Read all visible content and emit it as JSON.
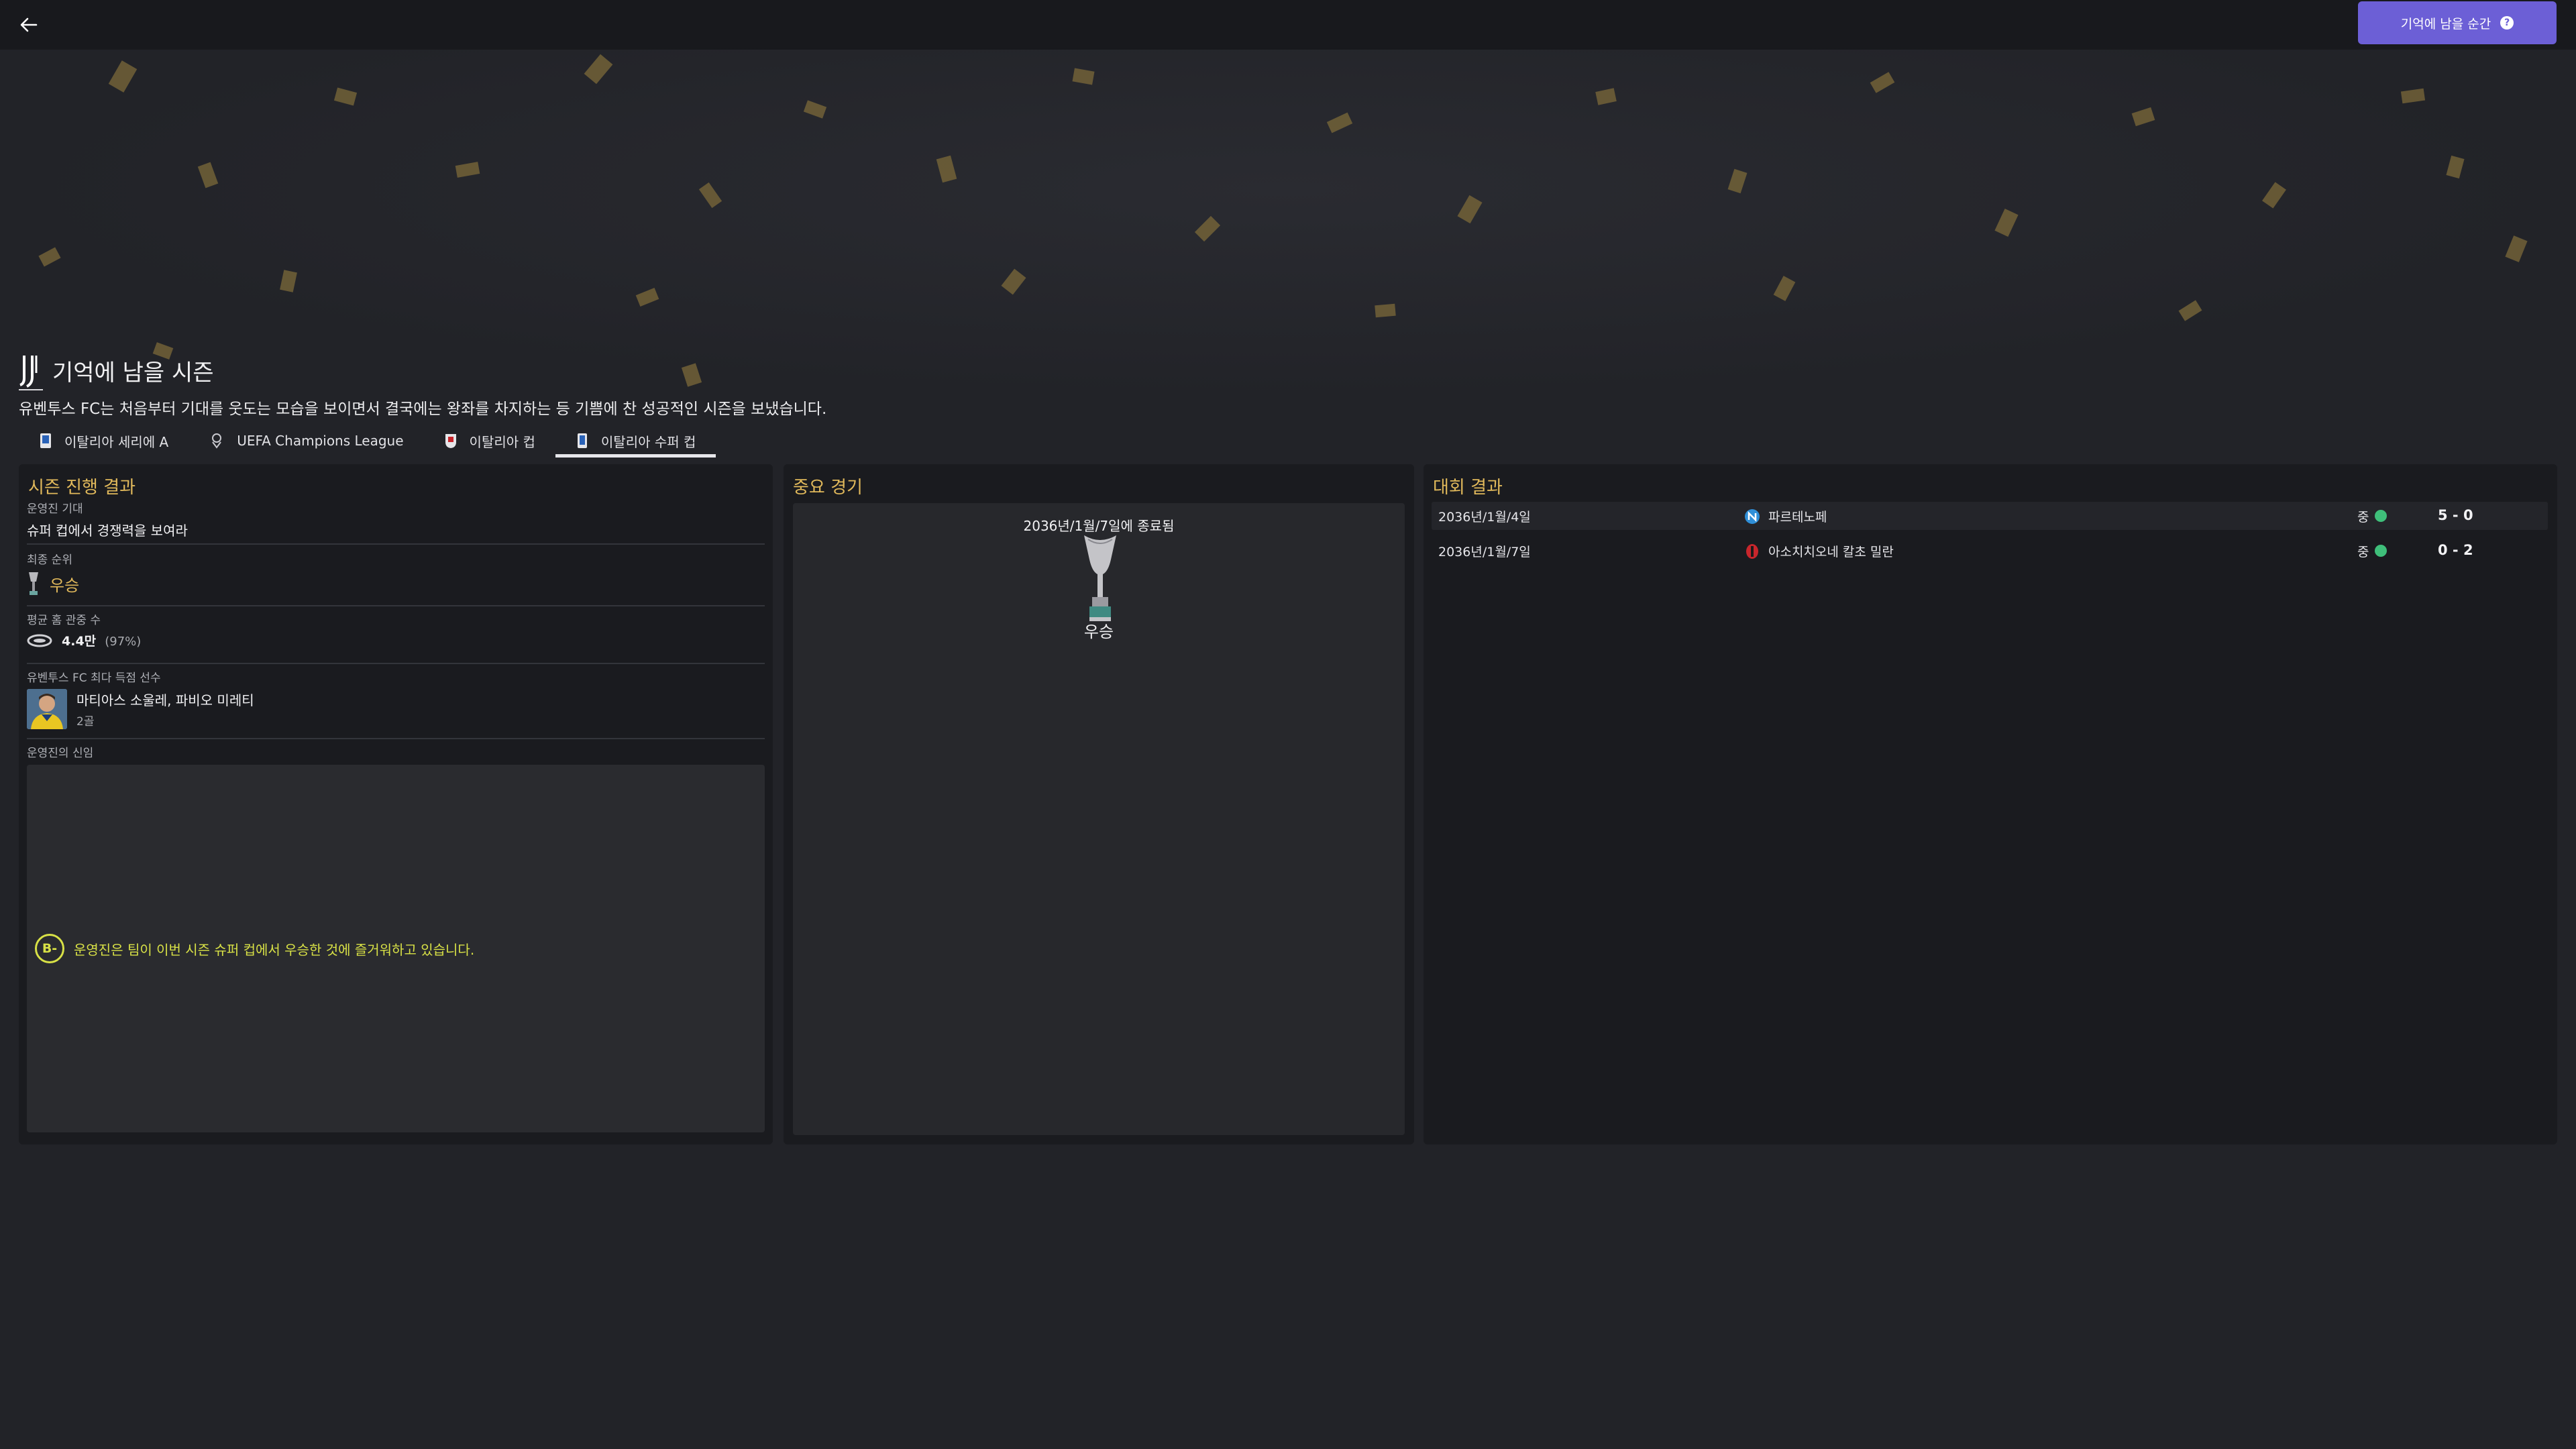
{
  "header": {
    "back_icon": "arrow-left-icon",
    "memory_button_label": "기억에 남을 순간",
    "memory_button_icon": "question-icon",
    "accent_color": "#6c5fd6"
  },
  "season": {
    "title": "기억에 남을 시즌",
    "subtitle": "유벤투스 FC는 처음부터 기대를 웃도는 모습을 보이면서 결국에는 왕좌를 차지하는 등 기쁨에 찬 성공적인 시즌을 보냈습니다."
  },
  "tabs": [
    {
      "label": "이탈리아 세리에 A",
      "icon": "serie-a-icon"
    },
    {
      "label": "UEFA Champions League",
      "icon": "champions-league-icon"
    },
    {
      "label": "이탈리아 컵",
      "icon": "italy-cup-icon"
    },
    {
      "label": "이탈리아 수퍼 컵",
      "icon": "supercup-icon",
      "active": true
    }
  ],
  "season_progress": {
    "title": "시즌 진행 결과",
    "board_expectation_label": "운영진 기대",
    "board_expectation_value": "슈퍼 컵에서 경쟁력을 보여라",
    "final_position_label": "최종 순위",
    "final_position_value": "우승",
    "avg_attendance_label": "평균 홈 관중 수",
    "avg_attendance_value": "4.4만",
    "avg_attendance_pct": "(97%)",
    "top_scorer_label": "유벤투스 FC 최다 득점 선수",
    "top_scorer_name": "마티아스 소울레, 파비오 미레티",
    "top_scorer_goals": "2골",
    "board_confidence_label": "운영진의 신임",
    "board_confidence_grade": "B-",
    "board_confidence_text": "운영진은 팀이 이번 시즌 슈퍼 컵에서 우승한 것에 즐거워하고 있습니다."
  },
  "key_match": {
    "title": "중요 경기",
    "date": "2036년/1월/7일에 종료됨",
    "result": "우승"
  },
  "competition_results": {
    "title": "대회 결과",
    "rows": [
      {
        "date": "2036년/1월/4일",
        "opponent": "파르테노페",
        "venue": "중",
        "score": "5 - 0",
        "crest_color": "#2f8fd8"
      },
      {
        "date": "2036년/1월/7일",
        "opponent": "아소치치오네 칼초 밀란",
        "venue": "중",
        "score": "0 - 2",
        "crest_color": "#c8262c"
      }
    ]
  },
  "colors": {
    "gold": "#e1b95b",
    "confidence": "#d8e146",
    "win": "#3fbf7a"
  }
}
